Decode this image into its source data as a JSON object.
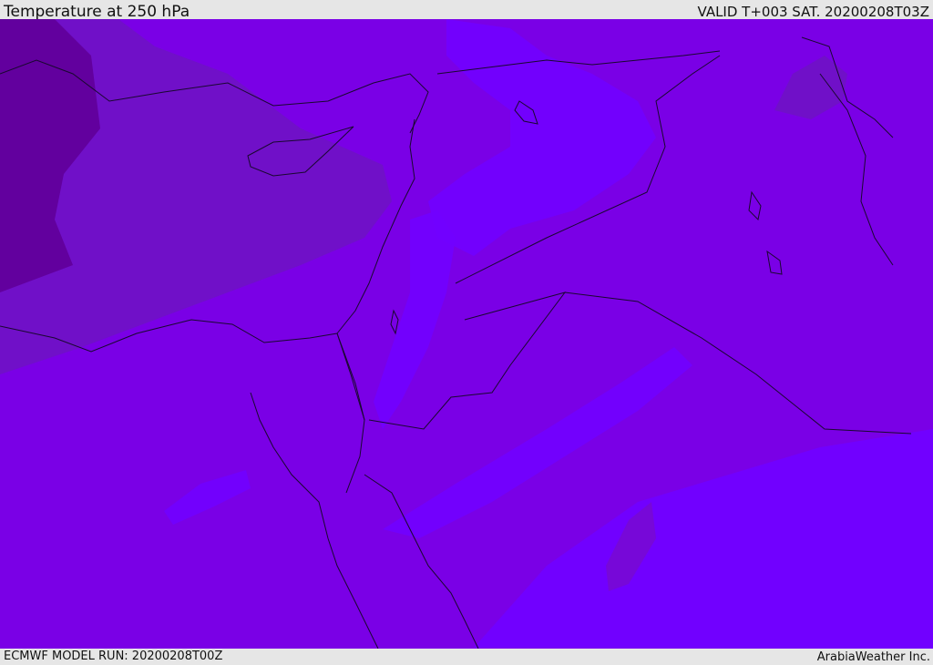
{
  "header": {
    "title": "Temperature at 250 hPa",
    "valid_time": "VALID T+003 SAT. 20200208T03Z"
  },
  "footer": {
    "model_run": "ECMWF MODEL RUN: 20200208T00Z",
    "credit": "ArabiaWeather Inc."
  },
  "colors": {
    "base": "#7a00e6",
    "warm_band": "#7100ff",
    "cold_band": "#7010c8",
    "coldest_band": "#62009e",
    "coastline": "#1a0830"
  }
}
